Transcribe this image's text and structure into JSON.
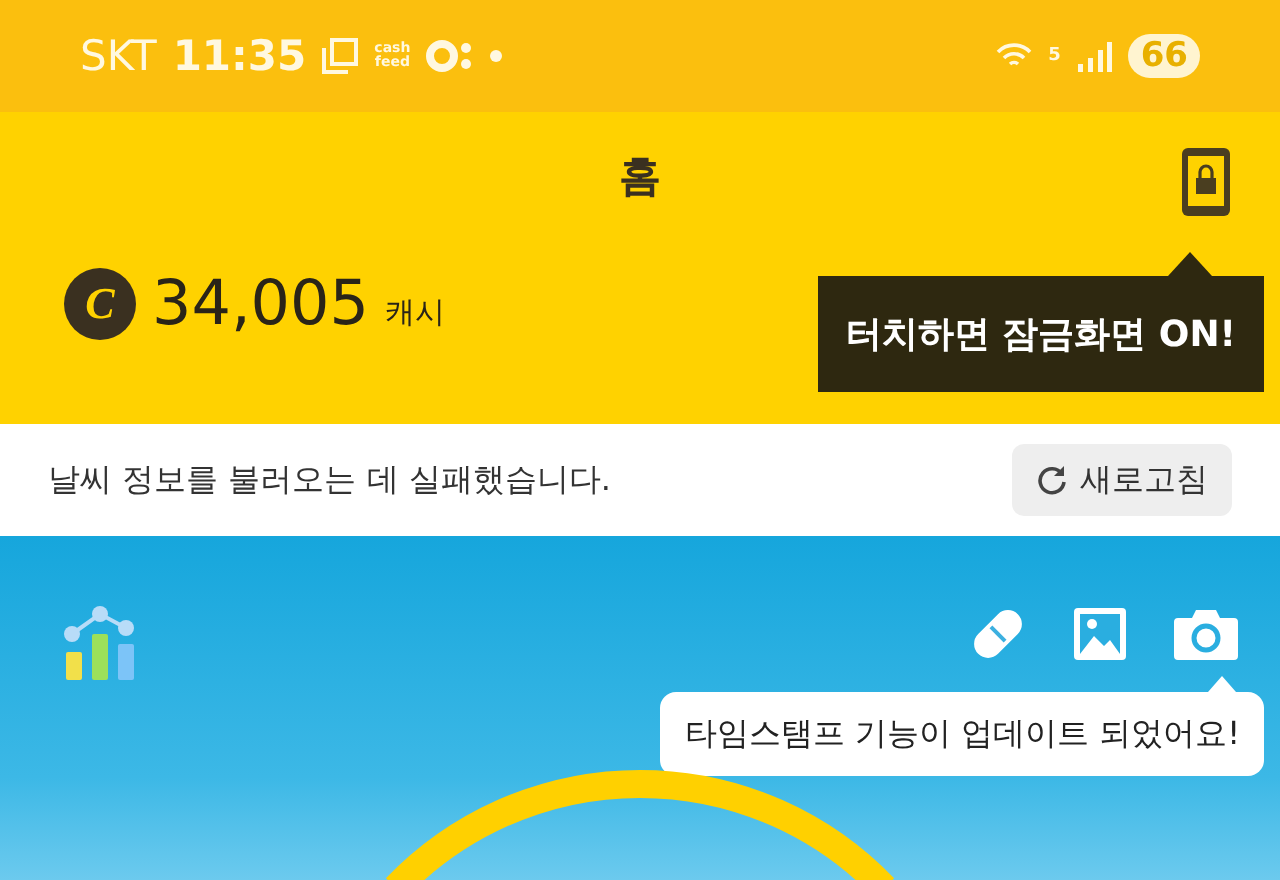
{
  "status_bar": {
    "carrier": "SKT",
    "time": "11:35",
    "app_logo": [
      "cash",
      "feed"
    ],
    "network": "5",
    "battery": "66"
  },
  "header": {
    "title": "홈",
    "lock_tooltip": "터치하면 잠금화면 ON!"
  },
  "balance": {
    "coin_symbol": "C",
    "amount": "34,005",
    "unit": "캐시"
  },
  "weather": {
    "message": "날씨 정보를 불러오는 데 실패했습니다.",
    "refresh_button": "새로고침"
  },
  "camera_tooltip": "타임스탬프 기능이 업데이트 되었어요!"
}
